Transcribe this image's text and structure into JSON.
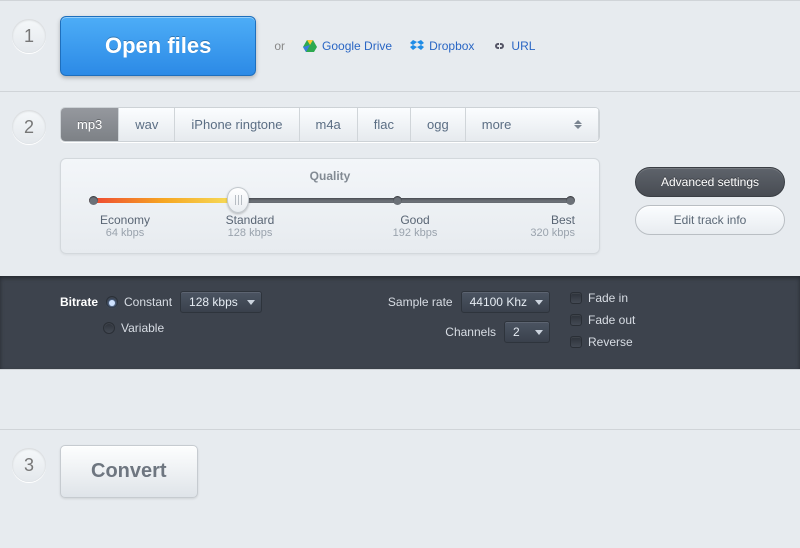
{
  "step1": {
    "open_label": "Open files",
    "or": "or",
    "gdrive": "Google Drive",
    "dropbox": "Dropbox",
    "url": "URL"
  },
  "step2": {
    "tabs": {
      "mp3": "mp3",
      "wav": "wav",
      "iphone": "iPhone ringtone",
      "m4a": "m4a",
      "flac": "flac",
      "ogg": "ogg",
      "more": "more"
    },
    "quality_title": "Quality",
    "quality_levels": [
      {
        "name": "Economy",
        "rate": "64 kbps"
      },
      {
        "name": "Standard",
        "rate": "128 kbps"
      },
      {
        "name": "Good",
        "rate": "192 kbps"
      },
      {
        "name": "Best",
        "rate": "320 kbps"
      }
    ],
    "advanced_btn": "Advanced settings",
    "edit_btn": "Edit track info"
  },
  "adv": {
    "bitrate_label": "Bitrate",
    "constant": "Constant",
    "variable": "Variable",
    "bitrate_value": "128 kbps",
    "samplerate_label": "Sample rate",
    "samplerate_value": "44100 Khz",
    "channels_label": "Channels",
    "channels_value": "2",
    "fade_in": "Fade in",
    "fade_out": "Fade out",
    "reverse": "Reverse"
  },
  "step3": {
    "convert": "Convert"
  }
}
